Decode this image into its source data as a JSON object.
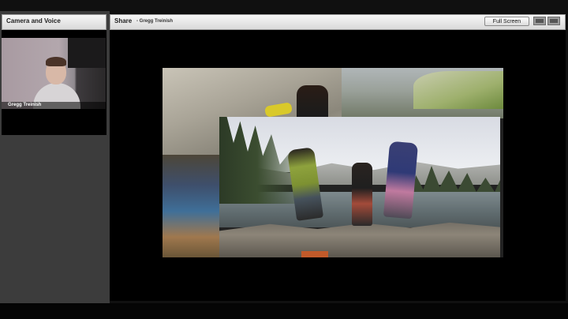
{
  "camera_pod": {
    "title": "Camera and Voice",
    "participant_name": "Gregg Treinish"
  },
  "share_pod": {
    "title": "Share",
    "presenter": "- Gregg Treinish",
    "fullscreen_label": "Full Screen"
  },
  "icons": [
    "webcam-feed",
    "screen-share",
    "layout-view-icon",
    "pod-options-icon"
  ],
  "colors": {
    "pod_header": "#e4e4e4",
    "background": "#000000",
    "sidebar": "#3c3c3c"
  }
}
